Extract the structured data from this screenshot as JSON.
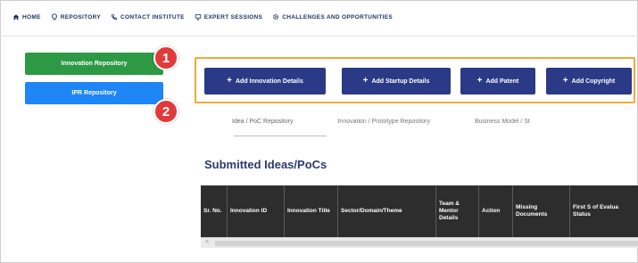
{
  "nav": {
    "items": [
      {
        "label": "HOME",
        "icon": "home-icon"
      },
      {
        "label": "REPOSITORY",
        "icon": "location-pin-icon"
      },
      {
        "label": "CONTACT INSTITUTE",
        "icon": "contact-icon"
      },
      {
        "label": "EXPERT SESSIONS",
        "icon": "presentation-icon"
      },
      {
        "label": "CHALLENGES AND OPPORTUNITIES",
        "icon": "gear-icon"
      }
    ]
  },
  "sidebar": {
    "innovation_label": "Innovation Repository",
    "ipr_label": "IPR Repository"
  },
  "badges": {
    "one": "1",
    "two": "2"
  },
  "actions": {
    "plus": "+",
    "innovation": "Add Innovation Details",
    "startup": "Add Startup Details",
    "patent": "Add Patent",
    "copyright": "Add Copyright"
  },
  "tabs": {
    "idea": "Idea / PoC Repository",
    "prototype": "Innovation / Prototype Repository",
    "business": "Business Model / St"
  },
  "section_title": "Submitted Ideas/PoCs",
  "table": {
    "headers": [
      "Sr. No.",
      "Innovation ID",
      "Innovation Title",
      "Sector/Domain/Theme",
      "Team & Mentor Details",
      "Action",
      "Missing Documents",
      "First S of Evalua Status"
    ],
    "scroll_arrow": "<"
  },
  "colors": {
    "innovation_button": "#2e9945",
    "ipr_button": "#1e86f7",
    "action_button": "#2b3a86",
    "highlight_border": "#f3a83b",
    "badge": "#e23a3a",
    "table_header": "#2d2d2d"
  }
}
